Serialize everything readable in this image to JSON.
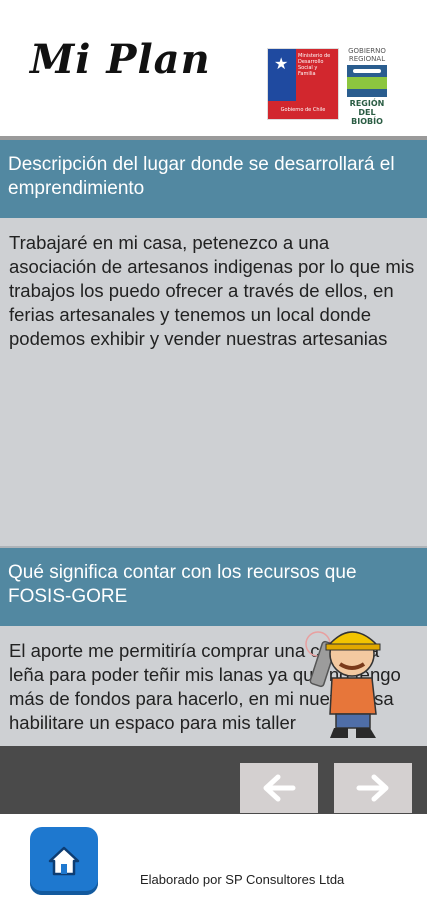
{
  "header": {
    "app_title": "Mi Plan",
    "ministry_logo_text": "Ministerio de Desarrollo Social y Familia",
    "ministry_logo_sub": "Gobierno de Chile",
    "gore_logo_top": "GOBIERNO REGIONAL",
    "gore_logo_region": "REGIÓN DEL BIOBÍO"
  },
  "sections": [
    {
      "title": "Descripción del lugar donde se desarrollará el emprendimiento",
      "body": "Trabajaré en mi casa, petenezco a una asociación de artesanos indigenas por lo que mis trabajos los puedo ofrecer a través de ellos, en ferias artesanales y tenemos un local donde podemos exhibir y vender nuestras artesanias"
    },
    {
      "title": "Qué significa contar con los recursos que FOSIS-GORE",
      "body": "El aporte me permitiría comprar una cocina a leña para poder teñir mis lanas ya que no tengo más de fondos para hacerlo, en mi nueva casa habilitare un espaco para mis taller"
    }
  ],
  "nav": {
    "prev_icon": "arrow-left-icon",
    "next_icon": "arrow-right-icon"
  },
  "footer": {
    "home_icon": "home-icon",
    "credit": "Elaborado por SP Consultores Ltda"
  },
  "colors": {
    "section_header_bg": "#5288a1",
    "section_body_bg": "#ced0d3",
    "navbar_bg": "#4a4a4a",
    "home_button": "#1e78cf"
  }
}
